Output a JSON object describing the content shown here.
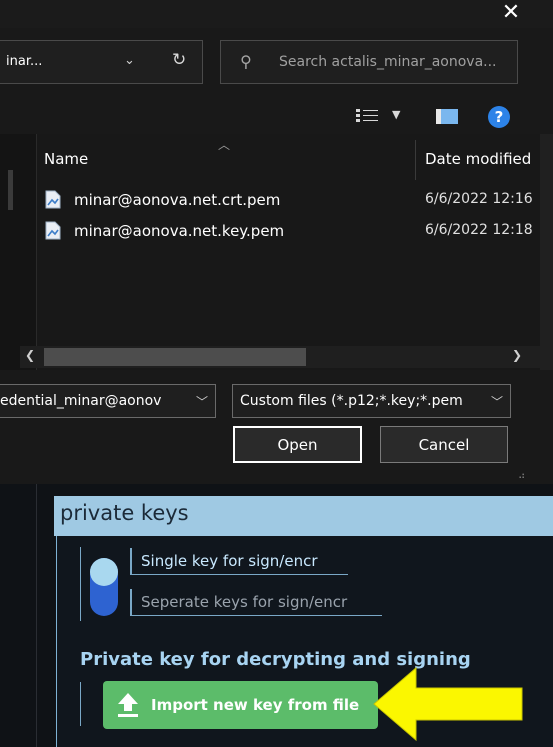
{
  "dialog": {
    "close_glyph": "✕",
    "address": {
      "text": "inar...",
      "chevron": "⌄",
      "refresh": "↻"
    },
    "search": {
      "icon": "search-icon",
      "placeholder": "Search actalis_minar_aonova..."
    },
    "toolbar": {
      "view_icon": "list-view-icon",
      "view_chevron": "▼",
      "preview_icon": "preview-pane-icon",
      "help_glyph": "?"
    },
    "columns": {
      "name": "Name",
      "date": "Date modified"
    },
    "files": [
      {
        "name": "minar@aonova.net.crt.pem",
        "date": "6/6/2022 12:16"
      },
      {
        "name": "minar@aonova.net.key.pem",
        "date": "6/6/2022 12:18"
      }
    ],
    "filename_value": "edential_minar@aonov",
    "filter_value": "Custom files (*.p12;*.key;*.pem",
    "open_label": "Open",
    "cancel_label": "Cancel"
  },
  "app": {
    "section_title": "private keys",
    "toggle_state": "single",
    "option_single": "Single key for sign/encr",
    "option_separate": "Seperate keys for sign/encr",
    "decrypt_label": "Private key for decrypting and signing",
    "import_label": "Import new key from file",
    "accent_color": "#9fc9e3",
    "button_color": "#5cbc6a",
    "arrow_color": "#fbf700"
  }
}
